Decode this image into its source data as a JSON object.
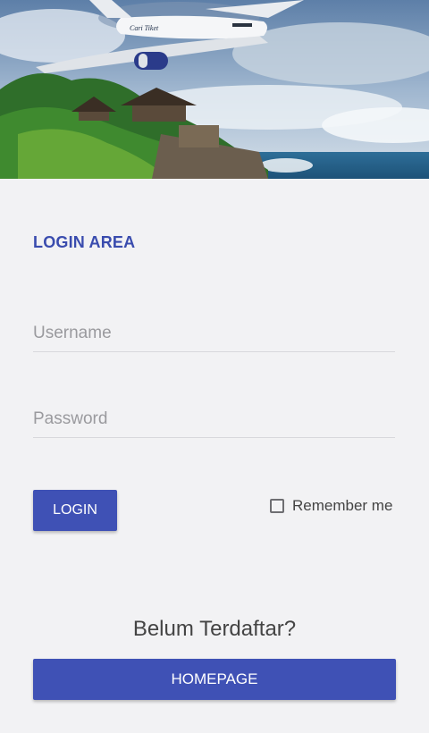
{
  "header_image": {
    "plane_livery_text": "Cari Tiket"
  },
  "login": {
    "title": "LOGIN AREA",
    "username_placeholder": "Username",
    "username_value": "",
    "password_placeholder": "Password",
    "password_value": "",
    "login_button": "LOGIN",
    "remember_label": "Remember me",
    "remember_checked": false
  },
  "register": {
    "prompt": "Belum Terdaftar?",
    "homepage_button": "HOMEPAGE"
  },
  "colors": {
    "accent": "#3f51b5",
    "title": "#3a4cae",
    "background": "#f2f2f4"
  }
}
